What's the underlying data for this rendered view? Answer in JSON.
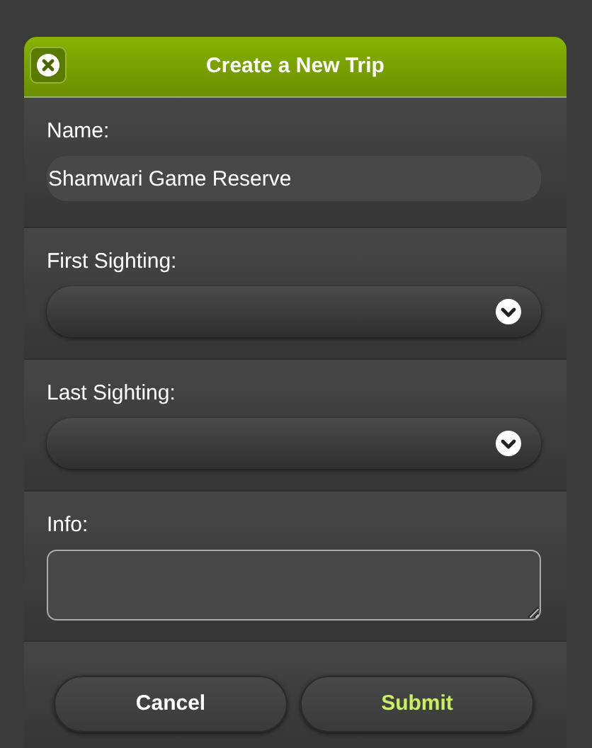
{
  "dialog": {
    "title": "Create a New Trip"
  },
  "fields": [
    {
      "kind": "text",
      "label": "Name:",
      "value": "Shamwari Game Reserve"
    },
    {
      "kind": "select",
      "label": "First Sighting:"
    },
    {
      "kind": "select",
      "label": "Last Sighting:"
    },
    {
      "kind": "textarea",
      "label": "Info:"
    }
  ],
  "buttons": [
    {
      "label": "Cancel",
      "primary": false
    },
    {
      "label": "Submit",
      "primary": true
    }
  ]
}
